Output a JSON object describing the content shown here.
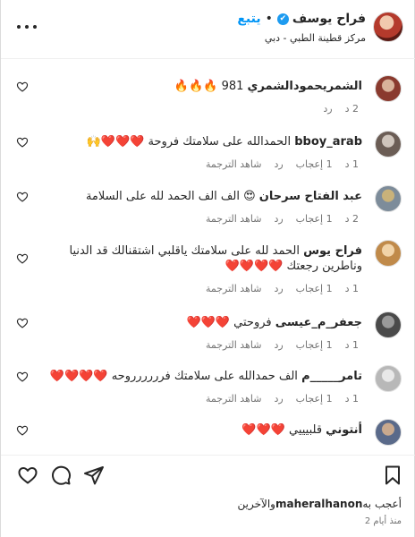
{
  "header": {
    "name": "فراح يوسف",
    "follow": "يتبع",
    "dot": "•",
    "verified": "✔",
    "location": "مركز قطينة الطبي - دبي",
    "avatar": "woman-red-hair-avatar"
  },
  "labels": {
    "translate": "شاهد الترجمة",
    "reply": "رد",
    "like": "إعجاب"
  },
  "comments": [
    {
      "user": "الشمريحمودالشمري",
      "text": "981 🔥🔥🔥",
      "time": "2 د",
      "likes": "",
      "show_translate": false,
      "avatar_colors": [
        "#8a3a2e",
        "#d9b29a"
      ]
    },
    {
      "user": "bboy_arab",
      "text": "الحمدالله على سلامتك فروحة ❤️❤️❤️🙌",
      "time": "1 د",
      "likes": "1 إعجاب",
      "show_translate": true,
      "avatar_colors": [
        "#6b5d55",
        "#cfc5bc"
      ]
    },
    {
      "user": "عبد الفتاح سرحان",
      "text": "😍 الف الف الحمد لله على السلامة",
      "time": "2 د",
      "likes": "1 إعجاب",
      "show_translate": true,
      "avatar_colors": [
        "#7d8c9a",
        "#c9b27a"
      ]
    },
    {
      "user": "فراح يوس",
      "text": "الحمد لله على سلامتك ياقلبي اشتقنالك قد الدنيا وناطرين رجعتك ❤️❤️❤️❤️",
      "time": "1 د",
      "likes": "1 إعجاب",
      "show_translate": true,
      "avatar_colors": [
        "#c08a4a",
        "#f1d3a8"
      ]
    },
    {
      "user": "جعفر_م_عيسى",
      "text": "فروحتي ❤️❤️❤️",
      "time": "1 د",
      "likes": "1 إعجاب",
      "show_translate": true,
      "avatar_colors": [
        "#4a4a4a",
        "#9a9a9a"
      ]
    },
    {
      "user": "تامر_____م",
      "text": "الف حمدالله على سلامتك فرررررروحه ❤️❤️❤️❤️",
      "time": "1 د",
      "likes": "1 إعجاب",
      "show_translate": true,
      "avatar_colors": [
        "#b8b8b8",
        "#e8e8e8"
      ]
    },
    {
      "user": "أنتوني",
      "text": "قلبيييي ❤️❤️❤️",
      "time": "",
      "likes": "",
      "show_translate": false,
      "avatar_colors": [
        "#5a6a8a",
        "#c9a98e"
      ]
    }
  ],
  "actions": {
    "like_icon": "heart-outline-icon",
    "comment_icon": "comment-bubble-icon",
    "share_icon": "paper-plane-icon",
    "save_icon": "bookmark-icon"
  },
  "likes_summary": {
    "prefix": "أعجب به",
    "user": "maheralhanon",
    "suffix": "والآخرين"
  },
  "time_ago": "منذ أيام 2"
}
